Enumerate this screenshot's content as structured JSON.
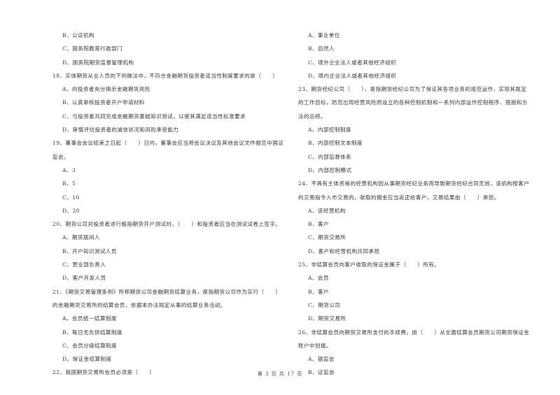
{
  "left_column": [
    {
      "type": "opt",
      "text": "B、公证机构"
    },
    {
      "type": "opt",
      "text": "C、国务院教育行政部门"
    },
    {
      "type": "opt",
      "text": "D、国务院期货监督管理机构"
    },
    {
      "type": "q",
      "text": "18、实体期货从业人员的下列做法中，不符合金融期货投资者适当性制度要求的是（　　）"
    },
    {
      "type": "opt",
      "text": "A、向投资者充分揭示金融期货风险"
    },
    {
      "type": "opt",
      "text": "B、认真审核投资者开户申请材料"
    },
    {
      "type": "opt",
      "text": "C、与投资者共同完成金融期货基础知识测试，以使其满足适当性标准要求"
    },
    {
      "type": "opt",
      "text": "D、审慎评估投资者的诚信状况和风险承受能力"
    },
    {
      "type": "q",
      "text": "19、董事会会议结束之日起（　　）日内，董事会应当将会议决议及其他会议文件报告中国证"
    },
    {
      "type": "q",
      "text": "监会。"
    },
    {
      "type": "opt",
      "text": "A、3"
    },
    {
      "type": "opt",
      "text": "B、5"
    },
    {
      "type": "opt",
      "text": "C、10"
    },
    {
      "type": "opt",
      "text": "D、20"
    },
    {
      "type": "q",
      "text": "20、期货公司对投资者进行股指期货开户测试时，（　　）和投资者应当在测试试卷上签字。"
    },
    {
      "type": "opt",
      "text": "A、期货居间人"
    },
    {
      "type": "opt",
      "text": "B、开户知识测试人员"
    },
    {
      "type": "opt",
      "text": "C、营业部负责人"
    },
    {
      "type": "opt",
      "text": "D、客户开发人员"
    },
    {
      "type": "q",
      "text": "21、《期货交易管理条例》所称期货公司金融期货结算业务，是指期货公司作为实行（　　）"
    },
    {
      "type": "q",
      "text": "的金融期货交易所的结算会员，依据本办法规定从事的结算业务活动。"
    },
    {
      "type": "opt",
      "text": "A、会员统一结算制度"
    },
    {
      "type": "opt",
      "text": "B、每日无负债结算制度"
    },
    {
      "type": "opt",
      "text": "C、会员分级结算制度"
    },
    {
      "type": "opt",
      "text": "D、保证金结算制度"
    },
    {
      "type": "q",
      "text": "22、我国期货交易所会员必须是（　　）"
    }
  ],
  "right_column": [
    {
      "type": "opt",
      "text": "A、事业单位"
    },
    {
      "type": "opt",
      "text": "B、自然人"
    },
    {
      "type": "opt",
      "text": "C、境外企业法人或者其他经济组织"
    },
    {
      "type": "opt",
      "text": "D、境内企业法人或者其他经济组织"
    },
    {
      "type": "q",
      "text": "23、期货经纪公司（　　），是指期货经纪公司为了保证其各项业务的规范运作，实现其既定"
    },
    {
      "type": "q",
      "text": "的工作目标，防范出现经营风险而设立的各种控制机制和一系列内部运作控制程序、措施和方"
    },
    {
      "type": "q",
      "text": "法的总称。"
    },
    {
      "type": "opt",
      "text": "A、内部控制制度"
    },
    {
      "type": "opt",
      "text": "B、内部控制文本制度"
    },
    {
      "type": "opt",
      "text": "C、内部监督体系"
    },
    {
      "type": "opt",
      "text": "D、内部控制模式"
    },
    {
      "type": "q",
      "text": "24、不具有主体资格的经营机构因从事期货经纪业务而导致期货经纪合同无效，该机构按客户"
    },
    {
      "type": "q",
      "text": "的交易指令入市交易的，收取的佣金应当返还给客户，交易结果由（　　）承担。"
    },
    {
      "type": "opt",
      "text": "A、该经营机构"
    },
    {
      "type": "opt",
      "text": "B、客户"
    },
    {
      "type": "opt",
      "text": "C、期货交易所"
    },
    {
      "type": "opt",
      "text": "D、客户和经营机构共同承担"
    },
    {
      "type": "q",
      "text": "25、非结算会员向客户收取的保证金属于（　　）所有。"
    },
    {
      "type": "opt",
      "text": "A、会员"
    },
    {
      "type": "opt",
      "text": "B、客户"
    },
    {
      "type": "opt",
      "text": "C、期货公司"
    },
    {
      "type": "opt",
      "text": "D、期货交易所"
    },
    {
      "type": "q",
      "text": "26、非结算会员向期货交易所支付的手续费，由（　　）从全面结算会员期货公司期货保证金"
    },
    {
      "type": "q",
      "text": "账户中划拨。"
    },
    {
      "type": "opt",
      "text": "A、银监会"
    },
    {
      "type": "opt",
      "text": "B、证监会"
    }
  ],
  "footer": {
    "page_label": "第 3 页 共 17 页"
  }
}
